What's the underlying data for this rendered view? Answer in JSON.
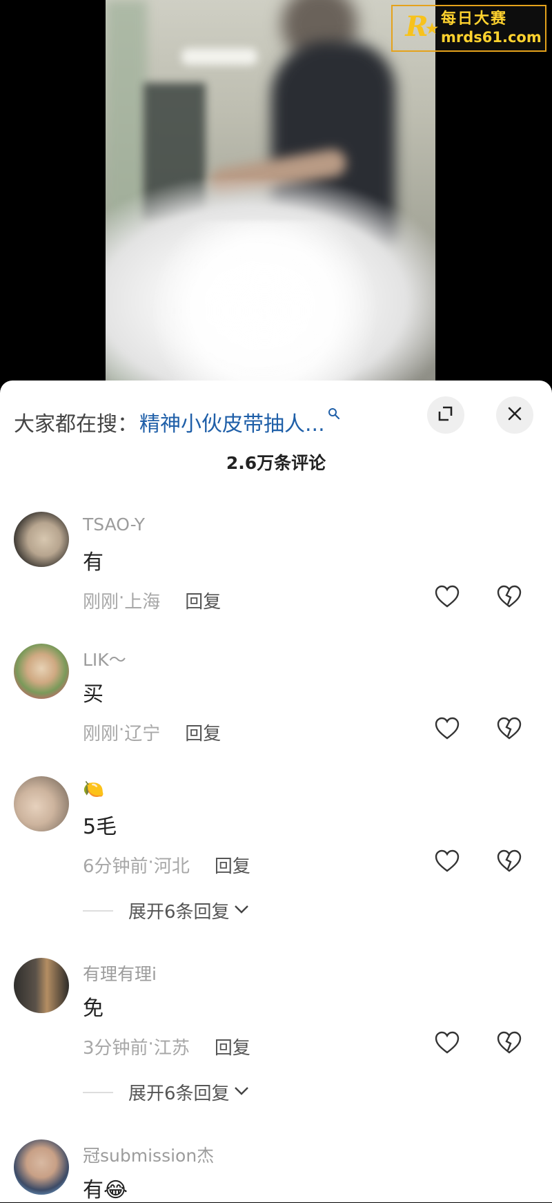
{
  "watermark": {
    "logo_letter": "R",
    "chinese_name": "每日大赛",
    "url": "mrds61.com",
    "accent_color": "#f7c21c"
  },
  "comments_panel": {
    "search_prefix": "大家都在搜：",
    "search_query": "精神小伙皮带抽人...",
    "comment_count_title": "2.6万条评论",
    "link_color": "#1f5fa8"
  },
  "comments": [
    {
      "username": "TSAO-Y",
      "text": "有",
      "time": "刚刚",
      "location": "上海",
      "reply_label": "回复",
      "expand_label": ""
    },
    {
      "username": "LIK～",
      "text": "买",
      "time": "刚刚",
      "location": "辽宁",
      "reply_label": "回复",
      "expand_label": ""
    },
    {
      "username": "",
      "username_emoji": "🍋",
      "text": "5毛",
      "time": "6分钟前",
      "location": "河北",
      "reply_label": "回复",
      "expand_label": "展开6条回复"
    },
    {
      "username": "有理有理i",
      "text": "免",
      "time": "3分钟前",
      "location": "江苏",
      "reply_label": "回复",
      "expand_label": "展开6条回复"
    },
    {
      "username": "冠submission杰",
      "text": "有😂",
      "time": "",
      "location": "",
      "reply_label": "",
      "expand_label": ""
    }
  ],
  "separator": " · "
}
